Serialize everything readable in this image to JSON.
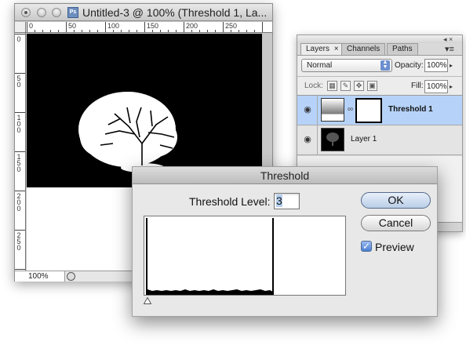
{
  "document": {
    "title": "Untitled-3 @ 100% (Threshold 1, La...",
    "app_icon_text": "Ps",
    "ruler_top": [
      "0",
      "50",
      "100",
      "150",
      "200",
      "250"
    ],
    "ruler_left": [
      "0",
      "5\n0",
      "1\n0\n0",
      "1\n5\n0",
      "2\n0\n0",
      "2\n5\n0"
    ],
    "zoom": "100%"
  },
  "layers_panel": {
    "tabs": [
      {
        "label": "Layers",
        "close": "×",
        "active": true
      },
      {
        "label": "Channels",
        "active": false
      },
      {
        "label": "Paths",
        "active": false
      }
    ],
    "menu_icon": "▾≡",
    "blend_mode": "Normal",
    "opacity_label": "Opacity:",
    "opacity_value": "100%",
    "lock_label": "Lock:",
    "fill_label": "Fill:",
    "fill_value": "100%",
    "layers": [
      {
        "name": "Threshold 1",
        "type": "adjustment",
        "visible": true,
        "selected": true
      },
      {
        "name": "Layer 1",
        "type": "image",
        "visible": true,
        "selected": false
      }
    ],
    "selection_color": "#b6d2f8"
  },
  "threshold_dialog": {
    "title": "Threshold",
    "level_label": "Threshold Level:",
    "level_value": "3",
    "ok_label": "OK",
    "cancel_label": "Cancel",
    "preview_label": "Preview",
    "preview_checked": true
  }
}
